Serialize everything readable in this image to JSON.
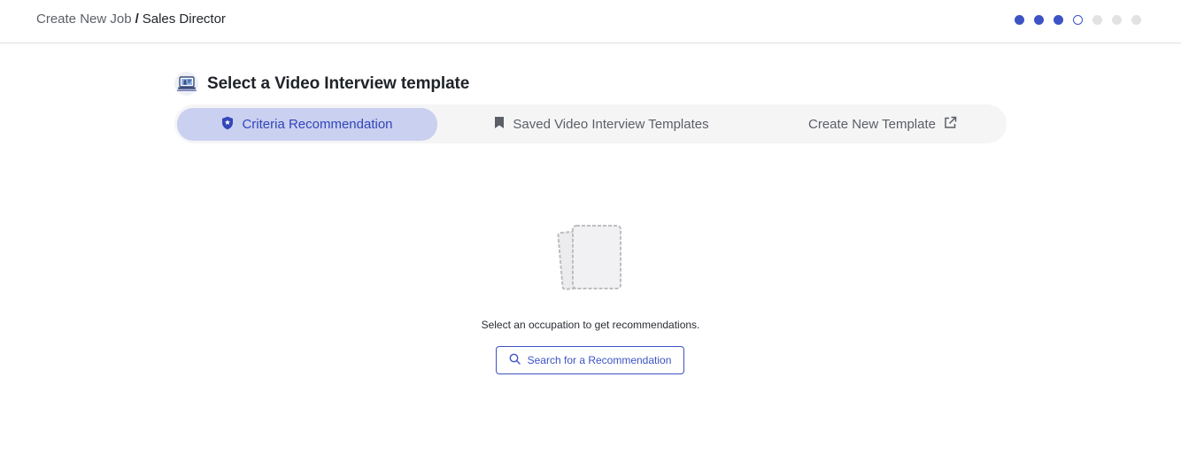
{
  "breadcrumb": {
    "parent": "Create New Job",
    "separator": "/",
    "current": "Sales Director"
  },
  "progress": {
    "total_steps": 7,
    "completed_steps": 3,
    "current_step": 4
  },
  "section": {
    "title": "Select a Video Interview template",
    "icon": "interview-computer-icon"
  },
  "tabs": [
    {
      "label": "Criteria Recommendation",
      "icon": "shield-star-icon",
      "active": true
    },
    {
      "label": "Saved Video Interview Templates",
      "icon": "bookmark-icon",
      "active": false
    },
    {
      "label": "Create New Template",
      "icon": "external-link-icon",
      "active": false
    }
  ],
  "empty_state": {
    "icon": "empty-documents-icon",
    "message": "Select an occupation to get recommendations.",
    "button_label": "Search for a Recommendation",
    "button_icon": "search-icon"
  },
  "colors": {
    "accent": "#3d53c4",
    "active_tab_bg": "#c9d0f0",
    "inactive_dot": "#e2e2e4"
  }
}
